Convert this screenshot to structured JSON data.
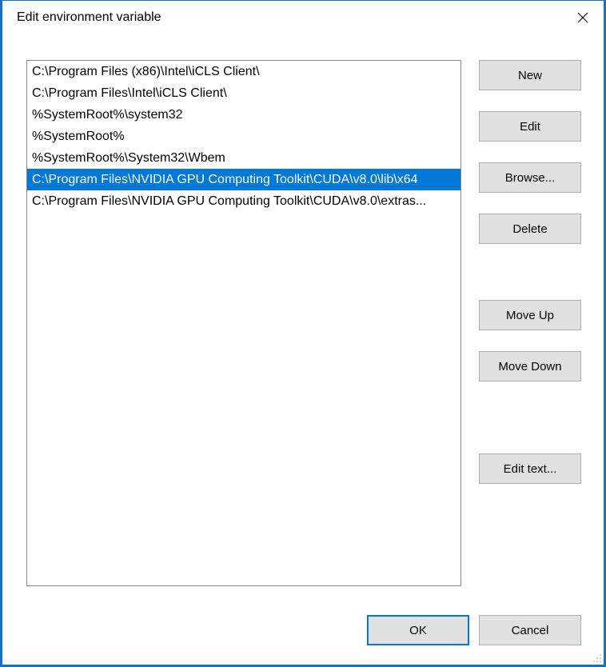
{
  "window": {
    "title": "Edit environment variable"
  },
  "list": {
    "selected_index": 5,
    "items": [
      "C:\\Program Files (x86)\\Intel\\iCLS Client\\",
      "C:\\Program Files\\Intel\\iCLS Client\\",
      "%SystemRoot%\\system32",
      "%SystemRoot%",
      "%SystemRoot%\\System32\\Wbem",
      "C:\\Program Files\\NVIDIA GPU Computing Toolkit\\CUDA\\v8.0\\lib\\x64",
      "C:\\Program Files\\NVIDIA GPU Computing Toolkit\\CUDA\\v8.0\\extras..."
    ]
  },
  "buttons": {
    "new": "New",
    "edit": "Edit",
    "browse": "Browse...",
    "delete": "Delete",
    "move_up": "Move Up",
    "move_down": "Move Down",
    "edit_text": "Edit text...",
    "ok": "OK",
    "cancel": "Cancel"
  }
}
